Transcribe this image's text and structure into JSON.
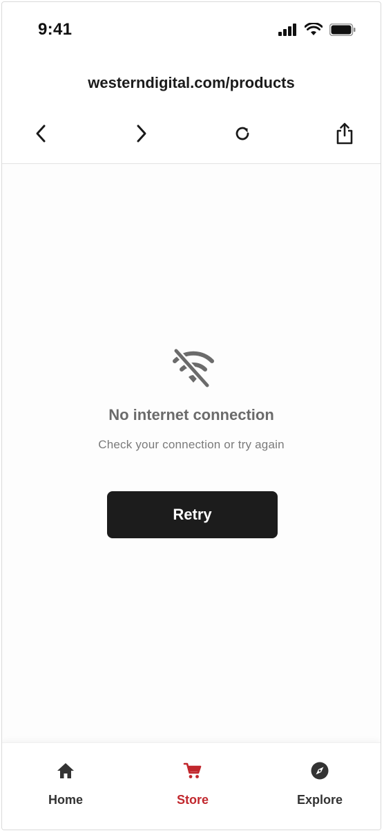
{
  "status_bar": {
    "time": "9:41"
  },
  "browser": {
    "url": "westerndigital.com/products"
  },
  "offline": {
    "title": "No internet connection",
    "subtitle": "Check your connection or try again",
    "retry_label": "Retry"
  },
  "tabs": [
    {
      "label": "Home",
      "icon": "home-icon",
      "active": false
    },
    {
      "label": "Store",
      "icon": "cart-icon",
      "active": true
    },
    {
      "label": "Explore",
      "icon": "compass-icon",
      "active": false
    }
  ],
  "colors": {
    "accent": "#c1272d",
    "button_bg": "#1c1c1c",
    "muted_text": "#6b6b6b"
  }
}
